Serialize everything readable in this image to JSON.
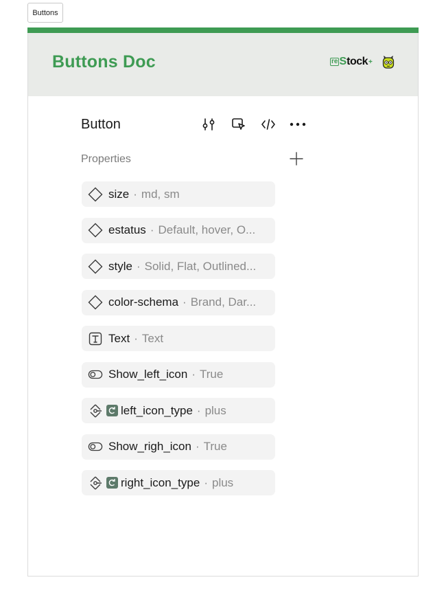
{
  "tab": {
    "label": "Buttons"
  },
  "header": {
    "title": "Buttons Doc",
    "brand": {
      "re": "re",
      "s": "S",
      "tock": "tock",
      "plus": "+"
    },
    "accent": "#3e9b53"
  },
  "component": {
    "title": "Button",
    "properties_label": "Properties",
    "toolbar": [
      "adjust-icon",
      "select-instance-icon",
      "code-icon",
      "more-icon"
    ]
  },
  "properties": [
    {
      "icon": "variant-icon",
      "name": "size",
      "sep": "·",
      "value": "md, sm"
    },
    {
      "icon": "variant-icon",
      "name": "estatus",
      "sep": "·",
      "value": "Default, hover, O..."
    },
    {
      "icon": "variant-icon",
      "name": "style",
      "sep": "·",
      "value": "Solid, Flat, Outlined..."
    },
    {
      "icon": "variant-icon",
      "name": "color-schema",
      "sep": "·",
      "value": "Brand, Dar..."
    },
    {
      "icon": "text-icon",
      "name": "Text",
      "sep": "·",
      "value": "Text"
    },
    {
      "icon": "toggle-icon",
      "name": "Show_left_icon",
      "sep": "·",
      "value": "True"
    },
    {
      "icon": "instance-swap-icon",
      "name": "left_icon_type",
      "sep": "·",
      "value": "plus"
    },
    {
      "icon": "toggle-icon",
      "name": "Show_righ_icon",
      "sep": "·",
      "value": "True"
    },
    {
      "icon": "instance-swap-icon",
      "name": "right_icon_type",
      "sep": "·",
      "value": "plus"
    }
  ]
}
